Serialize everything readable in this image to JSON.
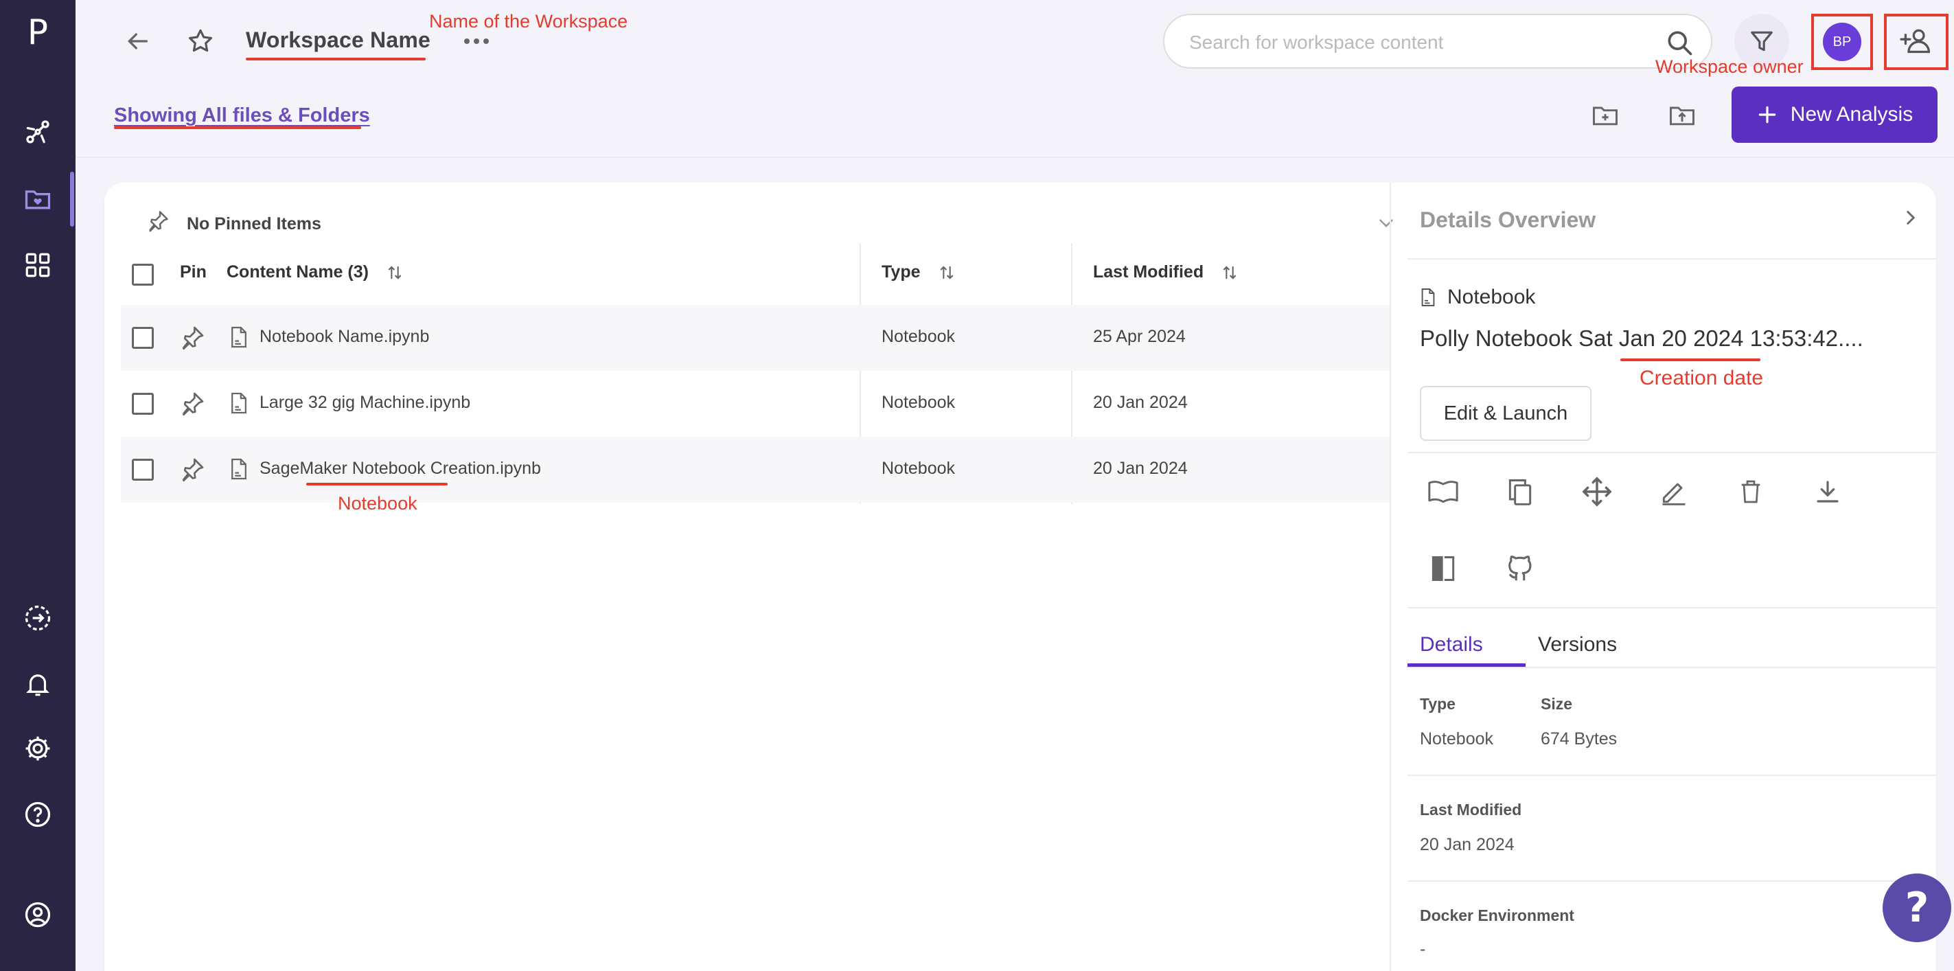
{
  "app": {
    "logo": "P"
  },
  "header": {
    "workspace_name": "Workspace Name",
    "search_placeholder": "Search for workspace content",
    "owner_initials": "BP"
  },
  "annotations": {
    "workspace_name": "Name of the Workspace",
    "workspace_owner": "Workspace owner",
    "notebook": "Notebook",
    "creation_date": "Creation date"
  },
  "toolbar": {
    "showing_label": "Showing All files & Folders",
    "new_analysis_label": "New Analysis"
  },
  "pinned": {
    "label": "No Pinned Items"
  },
  "table": {
    "columns": {
      "pin": "Pin",
      "content_name": "Content Name (3)",
      "type": "Type",
      "last_modified": "Last Modified"
    },
    "rows": [
      {
        "name": "Notebook Name.ipynb",
        "type": "Notebook",
        "last_modified": "25 Apr 2024"
      },
      {
        "name": "Large 32 gig Machine.ipynb",
        "type": "Notebook",
        "last_modified": "20 Jan 2024"
      },
      {
        "name": "SageMaker Notebook Creation.ipynb",
        "type": "Notebook",
        "last_modified": "20 Jan 2024"
      }
    ]
  },
  "details": {
    "header": "Details Overview",
    "kind": "Notebook",
    "title": "Polly Notebook Sat Jan 20 2024 13:53:42....",
    "edit_launch_label": "Edit & Launch",
    "tabs": {
      "details": "Details",
      "versions": "Versions"
    },
    "fields": {
      "type_label": "Type",
      "type_value": "Notebook",
      "size_label": "Size",
      "size_value": "674 Bytes",
      "last_modified_label": "Last Modified",
      "last_modified_value": "20 Jan 2024",
      "docker_label": "Docker Environment",
      "docker_value": "-"
    }
  },
  "colors": {
    "rail": "#2b2544",
    "accent": "#5b2fc2",
    "annotation": "#e53b2c"
  },
  "help": {
    "label": "?"
  }
}
